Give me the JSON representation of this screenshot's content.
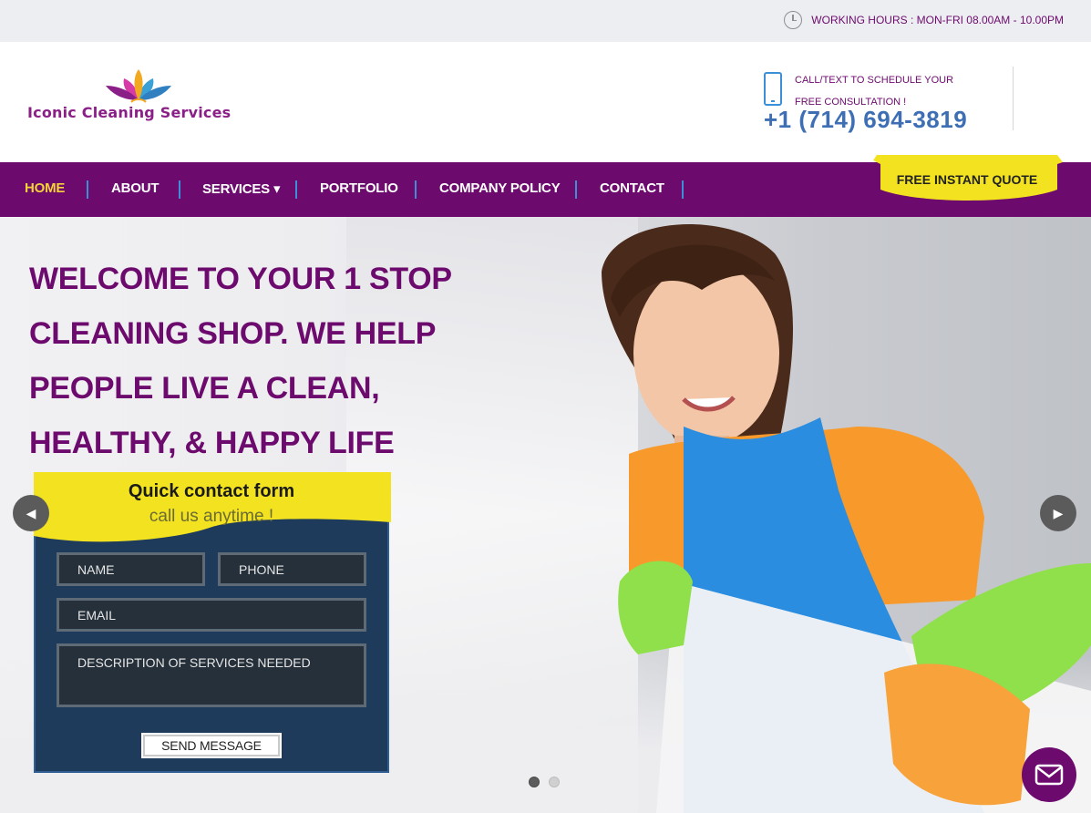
{
  "topbar": {
    "hours_text": "WORKING HOURS : MON-FRI 08.00AM - 10.00PM",
    "clock_icon": "clock-icon"
  },
  "header": {
    "logo_text": "Iconic Cleaning Services",
    "cta_text": "CALL/TEXT TO SCHEDULE YOUR FREE CONSULTATION !",
    "phone": "+1 (714) 694-3819",
    "phone_icon": "mobile-phone-icon"
  },
  "nav": {
    "items": [
      {
        "label": "HOME",
        "active": true
      },
      {
        "label": "ABOUT",
        "active": false
      },
      {
        "label": "SERVICES ▾",
        "active": false
      },
      {
        "label": "PORTFOLIO",
        "active": false
      },
      {
        "label": "COMPANY POLICY",
        "active": false
      },
      {
        "label": "CONTACT",
        "active": false
      }
    ],
    "quote_button": "FREE INSTANT QUOTE"
  },
  "hero": {
    "headline_lines": [
      "WELCOME TO YOUR 1 STOP",
      "CLEANING SHOP. WE HELP",
      "PEOPLE LIVE A CLEAN,",
      "HEALTHY, & HAPPY LIFE"
    ]
  },
  "form": {
    "title": "Quick contact form",
    "subtitle": "call us anytime !",
    "name_placeholder": "NAME",
    "phone_placeholder": "PHONE",
    "email_placeholder": "EMAIL",
    "description_placeholder": "DESCRIPTION OF SERVICES NEEDED",
    "send_label": "SEND MESSAGE"
  },
  "carousel": {
    "slides": 2,
    "current": 1,
    "prev_icon": "chevron-left-icon",
    "next_icon": "chevron-right-icon"
  },
  "chat": {
    "icon": "envelope-icon"
  },
  "colors": {
    "brand_purple": "#6d0a6e",
    "accent_yellow": "#f2e21f",
    "nav_separator_blue": "#3a8fd6",
    "form_navy": "#1e3b5c",
    "phone_blue": "#3e6fb4"
  }
}
